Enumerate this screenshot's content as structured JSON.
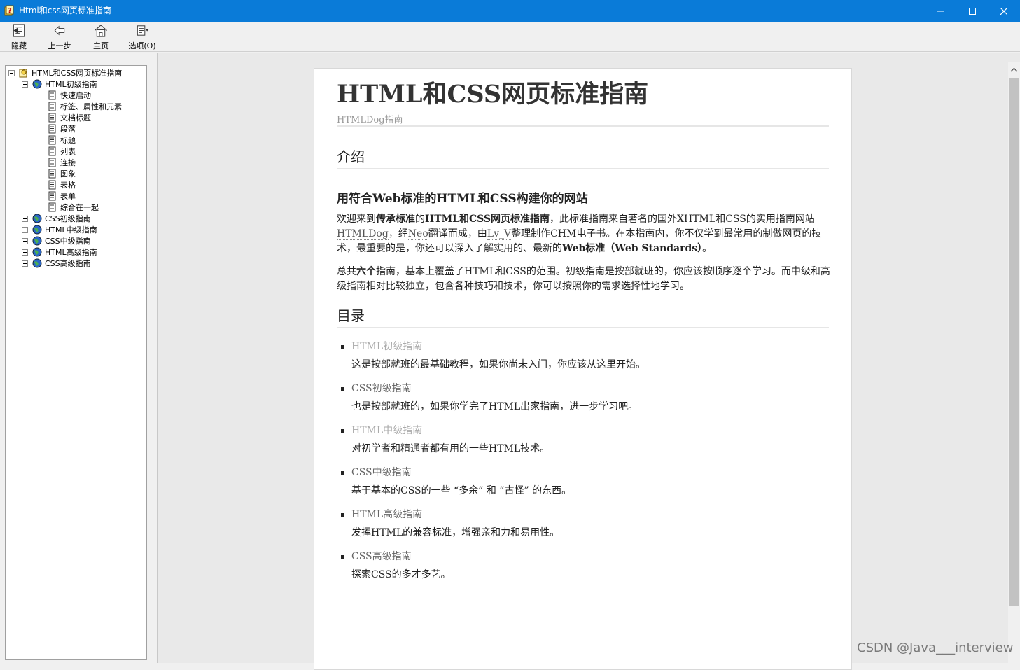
{
  "window": {
    "title": "Html和css网页标准指南",
    "minimize_glyph": "─",
    "maximize_glyph": "☐",
    "close_glyph": "✕"
  },
  "toolbar": {
    "hide": "隐藏",
    "back": "上一步",
    "home": "主页",
    "options": "选项(O)"
  },
  "tree": {
    "root": "HTML和CSS网页标准指南",
    "html_basic": "HTML初级指南",
    "html_basic_children": [
      "快速启动",
      "标签、属性和元素",
      "文档标题",
      "段落",
      "标题",
      "列表",
      "连接",
      "图象",
      "表格",
      "表单",
      "综合在一起"
    ],
    "others": [
      "CSS初级指南",
      "HTML中级指南",
      "CSS中级指南",
      "HTML高级指南",
      "CSS高级指南"
    ]
  },
  "article": {
    "title": "HTML和CSS网页标准指南",
    "subtitle": "HTMLDog指南",
    "intro_heading": "介绍",
    "intro_subheading": "用符合Web标准的HTML和CSS构建你的网站",
    "p1": {
      "t1": "欢迎来到",
      "b1": "传承标准",
      "t2": "的",
      "b2": "HTML和CSS网页标准指南",
      "t3": "，此标准指南来自著名的国外XHTML和CSS的实用指南网站",
      "l1": "HTMLDog",
      "t4": "，经",
      "l2": "Neo",
      "t5": "翻译而成，由",
      "l3": "Lv_V",
      "t6": "整理制作CHM电子书。在本指南内，你不仅学到最常用的制做网页的技术，最重要的是，你还可以深入了解实用的、最新的",
      "b3": "Web标准（Web Standards）",
      "t7": "。"
    },
    "p2": {
      "t1": "总共",
      "b1": "六个",
      "t2": "指南，基本上覆盖了HTML和CSS的范围。初级指南是按部就班的，你应该按顺序逐个学习。而中级和高级指南相对比较独立，包含各种技巧和技术，你可以按照你的需求选择性地学习。"
    },
    "toc_heading": "目录",
    "toc": [
      {
        "title": "HTML初级指南",
        "desc": "这是按部就班的最基础教程，如果你尚未入门，你应该从这里开始。"
      },
      {
        "title": "CSS初级指南",
        "desc": "也是按部就班的，如果你学完了HTML出家指南，进一步学习吧。"
      },
      {
        "title": "HTML中级指南",
        "desc": "对初学者和精通者都有用的一些HTML技术。"
      },
      {
        "title": "CSS中级指南",
        "desc": "基于基本的CSS的一些 “多余” 和 “古怪” 的东西。"
      },
      {
        "title": "HTML高级指南",
        "desc": "发挥HTML的兼容标准，增强亲和力和易用性。"
      },
      {
        "title": "CSS高级指南",
        "desc": "探索CSS的多才多艺。"
      }
    ]
  },
  "watermark": "CSDN @Java___interview",
  "colors": {
    "titlebar": "#0a7bd8",
    "toolbar": "#f0f0f0",
    "content_bg": "#e9e9e9",
    "page_bg": "#ffffff",
    "link_visited": "#aaaaaa",
    "link": "#666666"
  }
}
